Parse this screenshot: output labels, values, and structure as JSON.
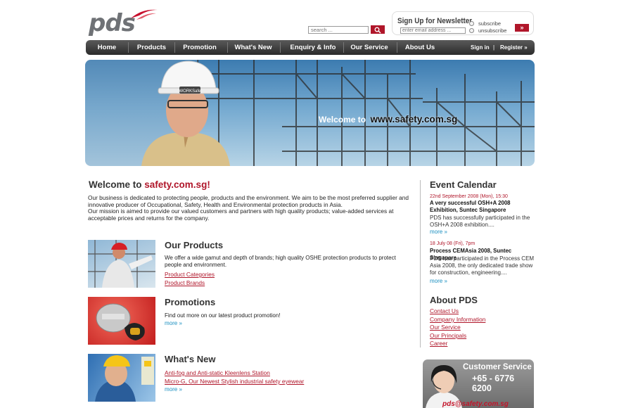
{
  "logo": {
    "text": "pds"
  },
  "search": {
    "placeholder": "search ..."
  },
  "newsletter": {
    "title": "Sign Up for Newsletter",
    "email_placeholder": "enter email address ...",
    "subscribe_label": "subscribe",
    "unsubscribe_label": "unsubscribe",
    "go_label": "»"
  },
  "nav": {
    "items": [
      "Home",
      "Products",
      "Promotion",
      "What's New",
      "Enquiry & Info",
      "Our Service",
      "About Us"
    ],
    "sign_in": "Sign in",
    "separator": "|",
    "register": "Register »"
  },
  "banner": {
    "welcome": "Welcome to",
    "url": "www.safety.com.sg",
    "helmet_text": "WORKSafe"
  },
  "welcome": {
    "title_prefix": "Welcome to",
    "title_site": "safety.com.sg!",
    "para1": "Our business is dedicated to protecting people, products and the environment. We aim to be the most preferred supplier and innovative producer of Occupational, Safety, Health and Environmental protection products in Asia.",
    "para2": "Our mission is aimed to provide our valued customers and partners with high quality products; value-added services at acceptable prices and returns for the company."
  },
  "products": {
    "title": "Our Products",
    "text": "We offer a wide gamut and depth of brands; high quality OSHE protection products to protect people and environment.",
    "link1": "Product Categories",
    "link2": "Product Brands"
  },
  "promotions": {
    "title": "Promotions",
    "text": "Find out more on our latest product promotion!",
    "more": "more »"
  },
  "whatsnew": {
    "title": "What's New",
    "link1": "Anti-fog and Anti-static Kleenlens Station",
    "link2": "Micro-G, Our Newest Stylish industrial safety eyewear",
    "more": "more »"
  },
  "events": {
    "title": "Event Calendar",
    "items": [
      {
        "date": "22nd September 2008 (Mon), 15:30",
        "headline": "A very successful OSH+A 2008 Exhibition, Suntec Singapore",
        "body": "PDS has successfully participated in the OSH+A 2008 exhibition....",
        "more": "more »"
      },
      {
        "date": "18 July 08 (Fri), 7pm",
        "headline": "Process CEMAsia 2008, Suntec Singapore",
        "body": "PDS has participated in the Process CEM Asia 2008, the only dedicated trade show for construction, engineering....",
        "more": "more »"
      }
    ]
  },
  "about": {
    "title": "About PDS",
    "links": [
      "Contact Us",
      "Company Information",
      "Our Service",
      "Our Principals",
      "Career"
    ]
  },
  "customer_service": {
    "title": "Customer Service",
    "phone": "+65 - 6776 6200",
    "email": "pds@safety.com.sg"
  },
  "colors": {
    "brand_red": "#b0162a",
    "nav_dark": "#2b2b2b",
    "link_blue": "#1a8fc0"
  }
}
